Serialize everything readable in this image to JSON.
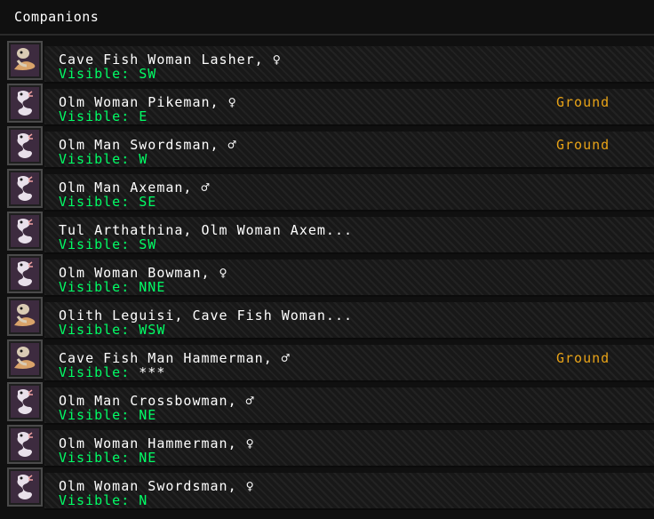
{
  "panel": {
    "title": "Companions"
  },
  "visible_prefix": "Visible: ",
  "colors": {
    "name": "#ffffff",
    "visible": "#00ff66",
    "status": "#e8a317",
    "portrait_bg": "#3d2b3f"
  },
  "companions": [
    {
      "name": "Cave Fish Woman Lasher, ♀",
      "visible": "SW",
      "status": "",
      "portrait_icon": "cave-fish-icon"
    },
    {
      "name": "Olm Woman Pikeman, ♀",
      "visible": "E",
      "status": "Ground",
      "portrait_icon": "olm-icon"
    },
    {
      "name": "Olm Man Swordsman, ♂",
      "visible": "W",
      "status": "Ground",
      "portrait_icon": "olm-icon"
    },
    {
      "name": "Olm Man Axeman, ♂",
      "visible": "SE",
      "status": "",
      "portrait_icon": "olm-icon"
    },
    {
      "name": "Tul Arthathina, Olm Woman Axem...",
      "visible": "SW",
      "status": "",
      "portrait_icon": "olm-icon"
    },
    {
      "name": "Olm Woman Bowman, ♀",
      "visible": "NNE",
      "status": "",
      "portrait_icon": "olm-icon"
    },
    {
      "name": "Olith Leguisi, Cave Fish Woman...",
      "visible": "WSW",
      "status": "",
      "portrait_icon": "cave-fish-icon"
    },
    {
      "name": "Cave Fish Man Hammerman, ♂",
      "visible": "***",
      "status": "Ground",
      "portrait_icon": "cave-fish-icon"
    },
    {
      "name": "Olm Man Crossbowman, ♂",
      "visible": "NE",
      "status": "",
      "portrait_icon": "olm-icon"
    },
    {
      "name": "Olm Woman Hammerman, ♀",
      "visible": "NE",
      "status": "",
      "portrait_icon": "olm-icon"
    },
    {
      "name": "Olm Woman Swordsman, ♀",
      "visible": "N",
      "status": "",
      "portrait_icon": "olm-icon"
    }
  ]
}
